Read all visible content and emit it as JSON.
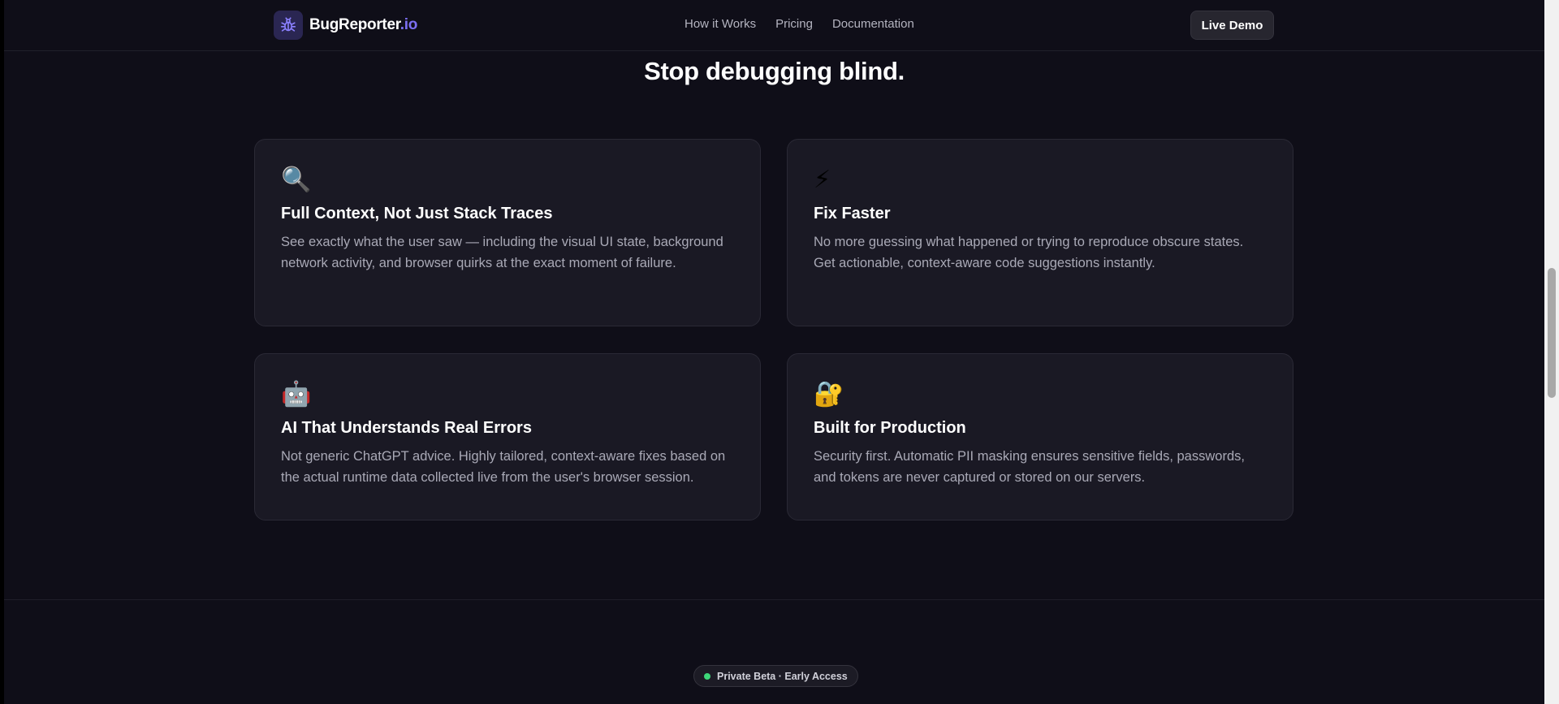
{
  "brand": {
    "name": "BugReporter",
    "suffix": ".io",
    "icon": "bug-icon",
    "accent_color": "#7c6ff2"
  },
  "nav": {
    "links": [
      "How it Works",
      "Pricing",
      "Documentation"
    ],
    "cta": "Live Demo"
  },
  "section": {
    "heading": "Stop debugging blind.",
    "cards": [
      {
        "icon": "🔍",
        "icon_name": "magnifier-icon",
        "title": "Full Context, Not Just Stack Traces",
        "description": "See exactly what the user saw — including the visual UI state, background network activity, and browser quirks at the exact moment of failure."
      },
      {
        "icon": "⚡",
        "icon_name": "lightning-icon",
        "title": "Fix Faster",
        "description": "No more guessing what happened or trying to reproduce obscure states. Get actionable, context-aware code suggestions instantly."
      },
      {
        "icon": "🤖",
        "icon_name": "robot-icon",
        "title": "AI That Understands Real Errors",
        "description": "Not generic ChatGPT advice. Highly tailored, context-aware fixes based on the actual runtime data collected live from the user's browser session."
      },
      {
        "icon": "🔐",
        "icon_name": "lock-icon",
        "title": "Built for Production",
        "description": "Security first. Automatic PII masking ensures sensitive fields, passwords, and tokens are never captured or stored on our servers."
      }
    ]
  },
  "beta": {
    "label": "Private Beta · Early Access",
    "status_color": "#3dd779"
  }
}
